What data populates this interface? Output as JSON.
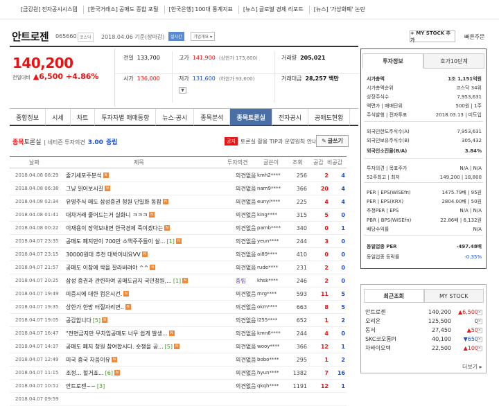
{
  "news": [
    {
      "cat": "[금감원]",
      "txt": "전자공시시스템"
    },
    {
      "cat": "[한국거래소]",
      "txt": "공매도 종합 포털"
    },
    {
      "cat": "[한국은행]",
      "txt": "100대 통계지표"
    },
    {
      "cat": "[뉴스]",
      "txt": "글로벌 경제 리포트"
    },
    {
      "cat": "[뉴스]",
      "txt": "'가상화폐' 논란"
    }
  ],
  "header": {
    "title": "안트로젠",
    "code": "065660",
    "market": "코스닥",
    "date": "2018.04.06 기준(장마감)",
    "realtime": "실시간",
    "corp": "기업개요 ▾",
    "mystock": "+ MY STOCK 추가",
    "quick": "빠른주문"
  },
  "price": {
    "current": "140,200",
    "change_label": "전일대비",
    "change": "▲6,500",
    "rate": "+4.86%"
  },
  "quote": {
    "prev_k": "전일",
    "prev": "133,700",
    "high_k": "고가",
    "high": "141,900",
    "upper": "(상한가 173,800)",
    "vol_k": "거래량",
    "vol": "205,021",
    "open_k": "시가",
    "open": "136,000",
    "low_k": "저가",
    "low": "131,600",
    "lower": "(하한가 93,600)",
    "amt_k": "거래대금",
    "amt": "28,257 백만"
  },
  "tabs": [
    "종합정보",
    "시세",
    "차트",
    "투자자별 매매동향",
    "뉴스·공시",
    "종목분석",
    "종목토론실",
    "전자공시",
    "공매도현황"
  ],
  "sub": {
    "red": "종목",
    "title": "토론실",
    "net": "| 네티즌 투자의견",
    "count": "3.00",
    "count_lbl": "중립"
  },
  "notice": {
    "tag": "공지",
    "text": "토론실 활용 TIP과 운영원칙 안내"
  },
  "write_label": "글쓰기",
  "thead": {
    "date": "날짜",
    "subject": "제목",
    "opinion": "투자의견",
    "author": "글쓴이",
    "views": "조회",
    "likes": "공감",
    "dislikes": "비공감"
  },
  "rows": [
    {
      "date": "2018.04.08 08:29",
      "subject": "줄기세포주분석",
      "cmt": "",
      "nb": true,
      "op": "의견없음",
      "au": "kmh2****",
      "v": "256",
      "l": "2",
      "d": "4"
    },
    {
      "date": "2018.04.08 06:38",
      "subject": "그냥 읽어보시길",
      "cmt": "",
      "nb": true,
      "op": "의견없음",
      "au": "nam9****",
      "v": "366",
      "l": "20",
      "d": "4"
    },
    {
      "date": "2018.04.08 02:34",
      "subject": "유명주식 매도 삼성증권 청원 단일화 동참",
      "cmt": "",
      "nb": true,
      "op": "의견없음",
      "au": "eunyi****",
      "v": "225",
      "l": "4",
      "d": "4"
    },
    {
      "date": "2018.04.08 01:41",
      "subject": "대차거래 줄어드는거 실화니 ㅋㅋㅋ",
      "cmt": "",
      "nb": true,
      "op": "의견없음",
      "au": "king****",
      "v": "315",
      "l": "5",
      "d": "0"
    },
    {
      "date": "2018.04.08 00:22",
      "subject": "이재용이 장악보내면 한국경제 죽이겠다는",
      "cmt": "",
      "nb": true,
      "op": "의견없음",
      "au": "pamb****",
      "v": "340",
      "l": "0",
      "d": "1"
    },
    {
      "date": "2018.04.07 23:35",
      "subject": "공매도 폐지만이 700만 소액주주들이 살...",
      "cmt": "[1]",
      "nb": true,
      "op": "의견없음",
      "au": "yeun****",
      "v": "244",
      "l": "3",
      "d": "0"
    },
    {
      "date": "2018.04.07 23:15",
      "subject": "30000원대 추천 대박이네요VV",
      "cmt": "",
      "nb": true,
      "op": "의견없음",
      "au": "ai89****",
      "v": "410",
      "l": "0",
      "d": "0"
    },
    {
      "date": "2018.04.07 21:57",
      "subject": "공매도 이참에 싹을 잘라버려야 ^^",
      "cmt": "",
      "nb": true,
      "op": "의견없음",
      "au": "rude****",
      "v": "231",
      "l": "2",
      "d": "0"
    },
    {
      "date": "2018.04.07 20:25",
      "subject": "삼성 증권과 관련하여 공매도금지 국민청원,...",
      "cmt": "[1]",
      "nb": true,
      "op": "중립",
      "au": "khsk****",
      "v": "246",
      "l": "2",
      "d": "0"
    },
    {
      "date": "2018.04.07 19:49",
      "subject": "미증시에 대한 컴은시건.",
      "cmt": "",
      "nb": true,
      "op": "의견없음",
      "au": "mrg****",
      "v": "593",
      "l": "11",
      "d": "5"
    },
    {
      "date": "2018.04.07 19:35",
      "subject": "상한가 한방 터질자리면..",
      "cmt": "",
      "nb": true,
      "op": "의견없음",
      "au": "okm****",
      "v": "663",
      "l": "8",
      "d": "5"
    },
    {
      "date": "2018.04.07 19:05",
      "subject": "공감합니다",
      "cmt": "[5]",
      "nb": true,
      "op": "의견없음",
      "au": "l255****",
      "v": "652",
      "l": "1",
      "d": "2"
    },
    {
      "date": "2018.04.07 16:47",
      "subject": "\"전면금지만 무차입공매도 너무 쉽게 발생...",
      "cmt": "",
      "nb": true,
      "op": "의견없음",
      "au": "kmn6****",
      "v": "244",
      "l": "4",
      "d": "0"
    },
    {
      "date": "2018.04.07 14:37",
      "subject": "공매도 폐지 청원 참여합시다. 숏쟁을 공...",
      "cmt": "[5]",
      "nb": true,
      "op": "의견없음",
      "au": "wooy****",
      "v": "366",
      "l": "12",
      "d": "1"
    },
    {
      "date": "2018.04.07 12:49",
      "subject": "미국 중국 차음이유",
      "cmt": "",
      "nb": true,
      "op": "의견없음",
      "au": "bobo****",
      "v": "295",
      "l": "1",
      "d": "2"
    },
    {
      "date": "2018.04.07 11:15",
      "subject": "조정... 헐거죠...",
      "cmt": "[6]",
      "nb": true,
      "op": "의견없음",
      "au": "hyun****",
      "v": "1382",
      "l": "7",
      "d": "16"
    },
    {
      "date": "2018.04.07 10:51",
      "subject": "안트로젠~~",
      "cmt": "[3]",
      "nb": false,
      "op": "의견없음",
      "au": "qkqh****",
      "v": "1191",
      "l": "12",
      "d": "1"
    },
    {
      "date": "2018.04.07 09:59",
      "subject": "",
      "cmt": "",
      "nb": false,
      "op": "",
      "au": "",
      "v": "",
      "l": "",
      "d": ""
    }
  ],
  "side": {
    "tab1": "투자정보",
    "tab2": "호가10단계",
    "rows": [
      {
        "k": "시가총액",
        "v": "1조 1,151억원",
        "bold": true
      },
      {
        "k": "시가총액순위",
        "v": "코스닥 34위"
      },
      {
        "k": "상장주식수",
        "v": "7,953,631"
      },
      {
        "k": "액면가 | 매매단위",
        "v": "500원 | 1주"
      },
      {
        "k": "주식발행 | 전자투표",
        "v": "2018.03.13 | 미도입"
      },
      {
        "k": "외국인한도주식수(A)",
        "v": "7,953,631"
      },
      {
        "k": "외국인보유주식수(B)",
        "v": "305,432"
      },
      {
        "k": "외국인소진율(B/A)",
        "v": "3.84%",
        "bold": true
      },
      {
        "k": "투자의견 | 목표주가",
        "v": "N/A | N/A"
      },
      {
        "k": "52주최고 | 최저",
        "v": "149,200 | 18,800"
      },
      {
        "k": "PER | EPS(WISEfn)",
        "v": "1475.79배 | 95원"
      },
      {
        "k": "PER | EPS(KRX)",
        "v": "2804.00배 | 50원"
      },
      {
        "k": "추정PER | EPS",
        "v": "N/A | N/A"
      },
      {
        "k": "PBR | BPS(WISEfn)",
        "v": "22.86배 | 6,132원"
      },
      {
        "k": "배당수익률",
        "v": "N/A"
      },
      {
        "k": "동일업종 PER",
        "v": "-497.48배",
        "bold": true
      },
      {
        "k": "동일업종 등락률",
        "v": "-0.35%",
        "blue": true
      }
    ]
  },
  "recent": {
    "tab1": "최근조회",
    "tab2": "MY STOCK",
    "more": "더보기 ▸",
    "rows": [
      {
        "n": "안트로젠",
        "p": "140,200",
        "c": "▲6,500",
        "up": true
      },
      {
        "n": "오리온",
        "p": "125,500",
        "c": "0",
        "up": null
      },
      {
        "n": "동서",
        "p": "27,450",
        "c": "▲50",
        "up": true
      },
      {
        "n": "SKC코오롱PI",
        "p": "40,100",
        "c": "▼650",
        "up": false
      },
      {
        "n": "차바이오텍",
        "p": "22,500",
        "c": "▲100",
        "up": true
      }
    ]
  },
  "colors": {
    "up": "#e11",
    "down": "#1a4fd0",
    "tab_active": "#4a6fa5"
  }
}
